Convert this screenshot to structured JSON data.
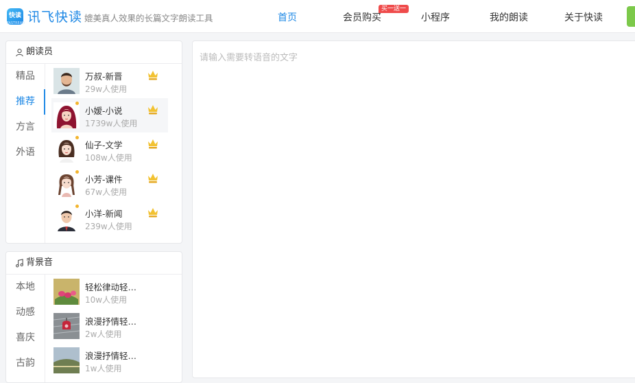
{
  "header": {
    "logo_text": "快读",
    "logo_subtext": "FASTREAD",
    "brand": "讯飞快读",
    "slogan": "媲美真人效果的长篇文字朗读工具",
    "nav": [
      {
        "label": "首页",
        "active": true
      },
      {
        "label": "会员购买",
        "badge": "买一送一"
      },
      {
        "label": "小程序"
      },
      {
        "label": "我的朗读"
      },
      {
        "label": "关于快读"
      }
    ]
  },
  "readers": {
    "title": "朗读员",
    "tabs": [
      "精品",
      "推荐",
      "方言",
      "外语"
    ],
    "active_tab": "推荐",
    "items": [
      {
        "name": "万叔-新晋",
        "count": "29w人使用"
      },
      {
        "name": "小嫒-小说",
        "count": "1739w人使用"
      },
      {
        "name": "仙子-文学",
        "count": "108w人使用"
      },
      {
        "name": "小芳-课件",
        "count": "67w人使用"
      },
      {
        "name": "小洋-新闻",
        "count": "239w人使用"
      }
    ]
  },
  "bgm": {
    "title": "背景音",
    "tabs": [
      "本地",
      "动感",
      "喜庆",
      "古韵"
    ],
    "items": [
      {
        "name": "轻松律动轻…",
        "count": "10w人使用"
      },
      {
        "name": "浪漫抒情轻…",
        "count": "2w人使用"
      },
      {
        "name": "浪漫抒情轻…",
        "count": "1w人使用"
      }
    ]
  },
  "editor": {
    "placeholder": "请输入需要转语音的文字"
  },
  "colors": {
    "accent": "#1e88e5",
    "badge": "#ef4b4b",
    "green": "#7cc94a"
  }
}
